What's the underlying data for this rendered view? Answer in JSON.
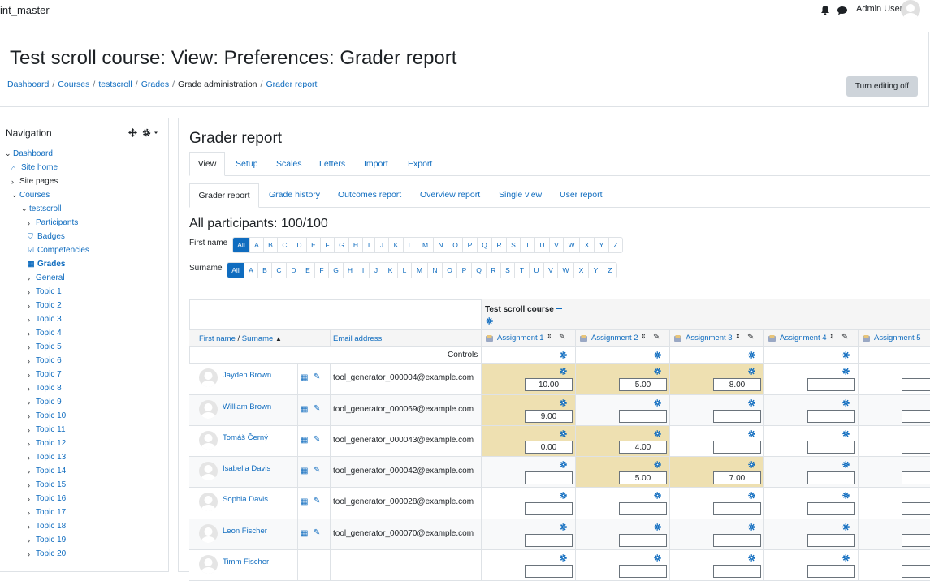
{
  "navbar": {
    "site_name": "int_master",
    "user_name": "Admin User"
  },
  "header": {
    "title": "Test scroll course: View: Preferences: Grader report",
    "breadcrumb": [
      "Dashboard",
      "Courses",
      "testscroll",
      "Grades",
      "Grade administration",
      "Grader report"
    ],
    "edit_button": "Turn editing off"
  },
  "nav": {
    "title": "Navigation",
    "items": [
      {
        "label": "Dashboard",
        "chevron": "⌄"
      },
      {
        "label": "Site home",
        "icon": "home-icon"
      },
      {
        "label": "Site pages",
        "chevron": "›"
      },
      {
        "label": "Courses",
        "chevron": "⌄"
      },
      {
        "label": "testscroll",
        "chevron": "⌄"
      },
      {
        "label": "Participants",
        "chevron": "›"
      },
      {
        "label": "Badges",
        "icon": "shield-icon"
      },
      {
        "label": "Competencies",
        "icon": "check-square-icon"
      },
      {
        "label": "Grades",
        "icon": "table-icon"
      },
      {
        "label": "General",
        "chevron": "›"
      },
      {
        "label": "Topic 1",
        "chevron": "›"
      },
      {
        "label": "Topic 2",
        "chevron": "›"
      },
      {
        "label": "Topic 3",
        "chevron": "›"
      },
      {
        "label": "Topic 4",
        "chevron": "›"
      },
      {
        "label": "Topic 5",
        "chevron": "›"
      },
      {
        "label": "Topic 6",
        "chevron": "›"
      },
      {
        "label": "Topic 7",
        "chevron": "›"
      },
      {
        "label": "Topic 8",
        "chevron": "›"
      },
      {
        "label": "Topic 9",
        "chevron": "›"
      },
      {
        "label": "Topic 10",
        "chevron": "›"
      },
      {
        "label": "Topic 11",
        "chevron": "›"
      },
      {
        "label": "Topic 12",
        "chevron": "›"
      },
      {
        "label": "Topic 13",
        "chevron": "›"
      },
      {
        "label": "Topic 14",
        "chevron": "›"
      },
      {
        "label": "Topic 15",
        "chevron": "›"
      },
      {
        "label": "Topic 16",
        "chevron": "›"
      },
      {
        "label": "Topic 17",
        "chevron": "›"
      },
      {
        "label": "Topic 18",
        "chevron": "›"
      },
      {
        "label": "Topic 19",
        "chevron": "›"
      },
      {
        "label": "Topic 20",
        "chevron": "›"
      }
    ]
  },
  "main": {
    "title": "Grader report",
    "tabs": [
      "View",
      "Setup",
      "Scales",
      "Letters",
      "Import",
      "Export"
    ],
    "subtabs": [
      "Grader report",
      "Grade history",
      "Outcomes report",
      "Overview report",
      "Single view",
      "User report"
    ],
    "participants": "All participants: 100/100",
    "first_name_label": "First name",
    "surname_label": "Surname",
    "initials": [
      "All",
      "A",
      "B",
      "C",
      "D",
      "E",
      "F",
      "G",
      "H",
      "I",
      "J",
      "K",
      "L",
      "M",
      "N",
      "O",
      "P",
      "Q",
      "R",
      "S",
      "T",
      "U",
      "V",
      "W",
      "X",
      "Y",
      "Z"
    ]
  },
  "table": {
    "course_name": "Test scroll course",
    "name_header_first": "First name",
    "name_header_sep": "/",
    "name_header_surname": "Surname",
    "email_header": "Email address",
    "controls_label": "Controls",
    "assignments": [
      "Assignment 1",
      "Assignment 2",
      "Assignment 3",
      "Assignment 4",
      "Assignment 5"
    ],
    "students": [
      {
        "name": "Jayden Brown",
        "email": "tool_generator_000004@example.com",
        "grades": [
          "10.00",
          "5.00",
          "8.00",
          "",
          ""
        ],
        "overridden": [
          true,
          true,
          true,
          false,
          false
        ]
      },
      {
        "name": "William Brown",
        "email": "tool_generator_000069@example.com",
        "grades": [
          "9.00",
          "",
          "",
          "",
          ""
        ],
        "overridden": [
          true,
          false,
          false,
          false,
          false
        ]
      },
      {
        "name": "Tomáš Černý",
        "email": "tool_generator_000043@example.com",
        "grades": [
          "0.00",
          "4.00",
          "",
          "",
          ""
        ],
        "overridden": [
          true,
          true,
          false,
          false,
          false
        ]
      },
      {
        "name": "Isabella Davis",
        "email": "tool_generator_000042@example.com",
        "grades": [
          "",
          "5.00",
          "7.00",
          "",
          ""
        ],
        "overridden": [
          false,
          true,
          true,
          false,
          false
        ]
      },
      {
        "name": "Sophia Davis",
        "email": "tool_generator_000028@example.com",
        "grades": [
          "",
          "",
          "",
          "",
          ""
        ],
        "overridden": [
          false,
          false,
          false,
          false,
          false
        ]
      },
      {
        "name": "Leon Fischer",
        "email": "tool_generator_000070@example.com",
        "grades": [
          "",
          "",
          "",
          "",
          ""
        ],
        "overridden": [
          false,
          false,
          false,
          false,
          false
        ]
      },
      {
        "name": "Timm Fischer",
        "email": "",
        "grades": [
          "",
          "",
          "",
          "",
          ""
        ],
        "overridden": [
          false,
          false,
          false,
          false,
          false
        ]
      }
    ]
  },
  "colors": {
    "link": "#0f6cbf",
    "overridden_cell": "#eee0b1",
    "selected_initial": "#0f6cbf"
  }
}
